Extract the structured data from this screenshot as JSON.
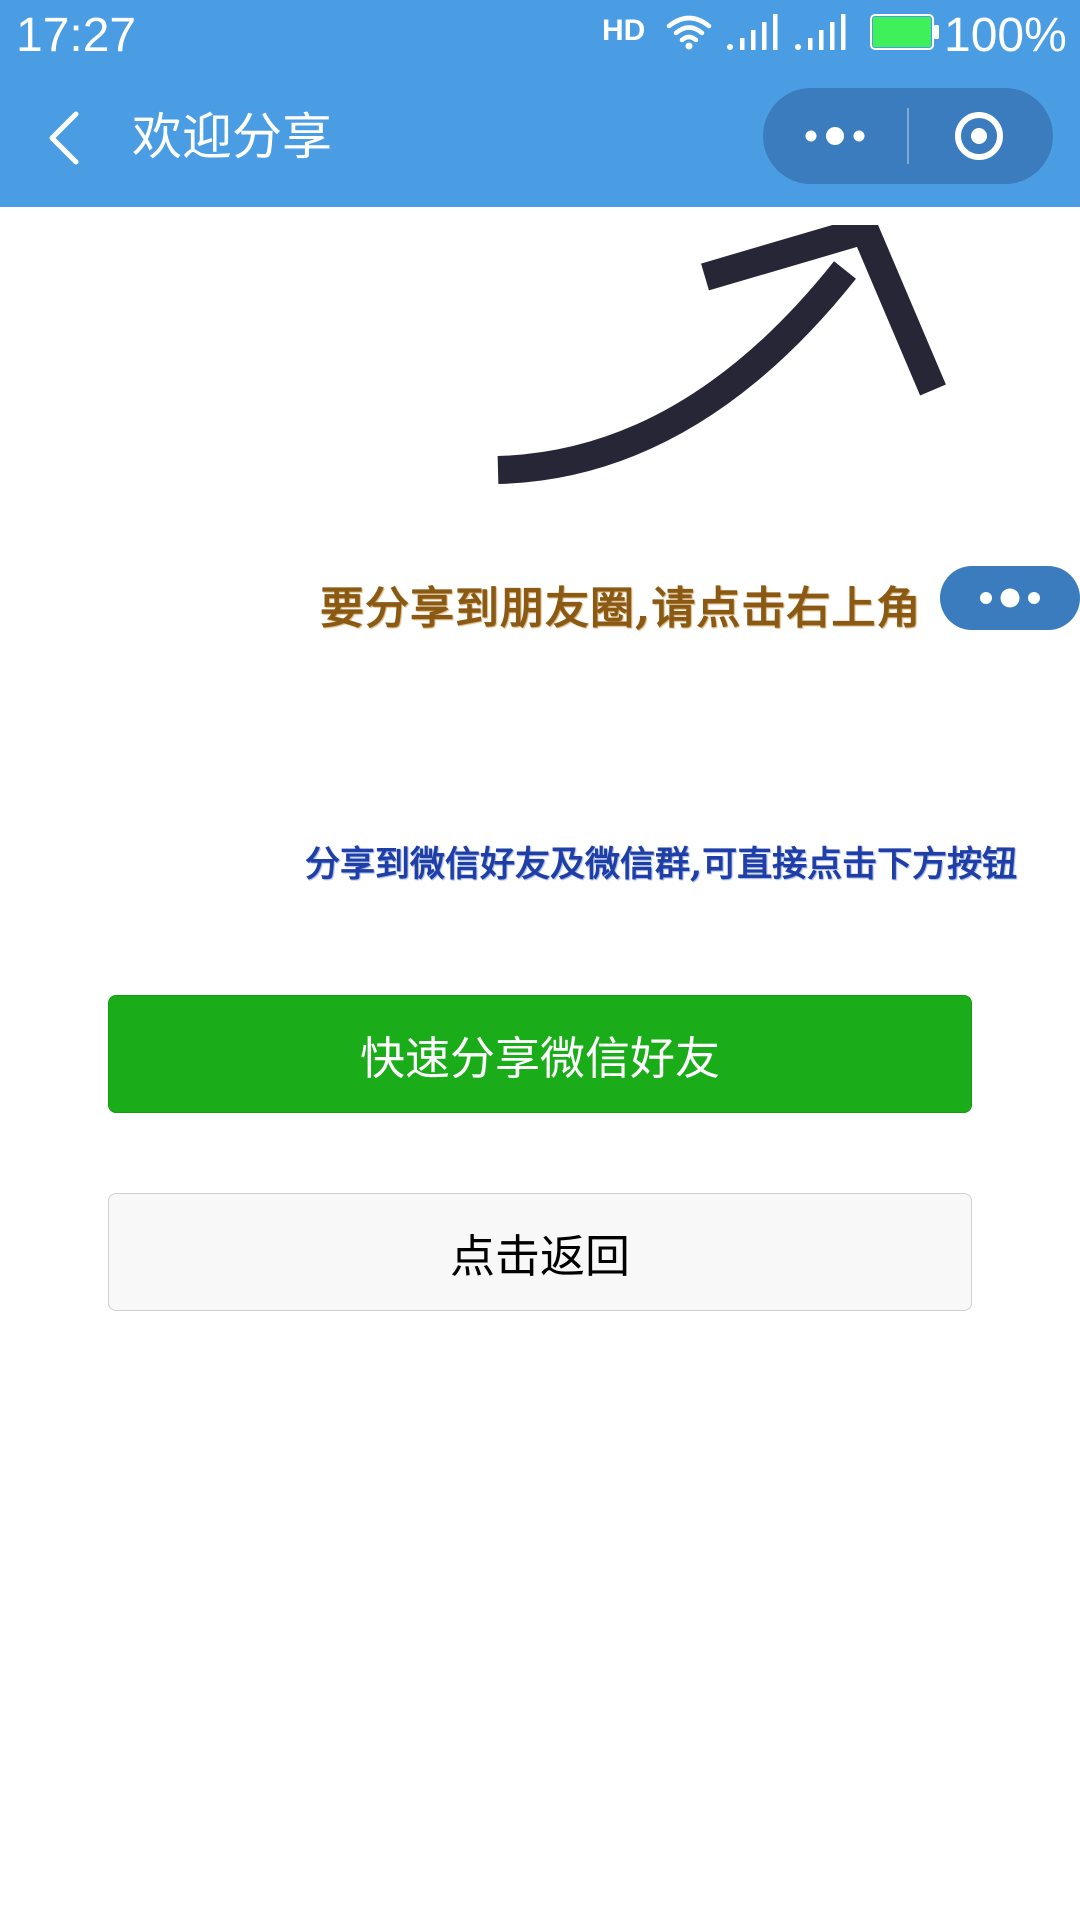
{
  "status_bar": {
    "time": "17:27",
    "network_label": "HD",
    "battery_percent": "100%",
    "battery_color": "#3ef05a",
    "icons": [
      "wifi-icon",
      "signal-icon",
      "signal-icon",
      "battery-icon"
    ]
  },
  "nav": {
    "title": "欢迎分享",
    "back_icon": "chevron-left-icon",
    "menu_icon": "more-dots-icon",
    "close_icon": "target-circle-icon",
    "color": "#4a9de3",
    "capsule_color": "#3a7cbd"
  },
  "content": {
    "arrow_icon": "curved-up-arrow-icon",
    "hint_moments": "要分享到朋友圈,请点击右上角",
    "hint_moments_color": "#8a5a14",
    "hint_friends": "分享到微信好友及微信群,可直接点击下方按钮",
    "hint_friends_color": "#1f3fa6",
    "share_button": "快速分享微信好友",
    "share_button_color": "#1aad19",
    "back_button": "点击返回"
  }
}
